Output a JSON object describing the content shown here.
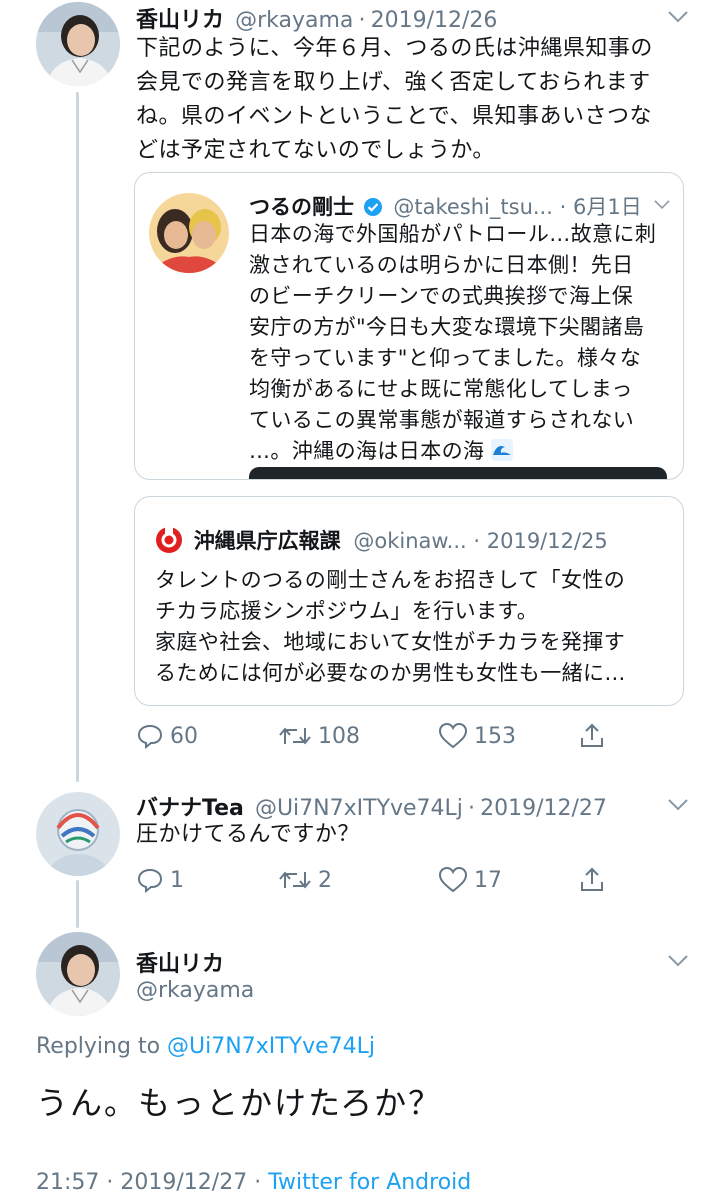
{
  "tweet1": {
    "name": "香山リカ",
    "handle": "@rkayama",
    "sep": "·",
    "date": "2019/12/26",
    "lines": [
      "下記のように、今年６月、つるの氏は沖縄県知事の",
      "会見での発言を取り上げ、強く否定しておられます",
      "ね。県のイベントということで、県知事あいさつな",
      "どは予定されてないのでしょうか。"
    ],
    "quote_outer": {
      "name": "つるの剛士",
      "handle": "@takeshi_tsu...",
      "sep": "·",
      "date": "6月1日",
      "lines": [
        "日本の海で外国船がパトロール…故意に刺",
        "激されているのは明らかに日本側！先日",
        "のビーチクリーンでの式典挨拶で海上保",
        "安庁の方が\"今日も大変な環境下尖閣諸島",
        "を守っています\"と仰ってました。様々な",
        "均衡があるにせよ既に常態化してしまっ",
        "ているこの異常事態が報道すらされない",
        "…。沖縄の海は日本の海"
      ]
    },
    "quote_inner": {
      "name": "沖縄県庁広報課",
      "handle": "@okinaw...",
      "sep": "·",
      "date": "2019/12/25",
      "lines": [
        "タレントのつるの剛士さんをお招きして「女性の",
        "チカラ応援シンポジウム」を行います。",
        "家庭や社会、地域において女性がチカラを発揮す",
        "るためには何が必要なのか男性も女性も一緒に…"
      ]
    },
    "replies": "60",
    "retweets": "108",
    "likes": "153"
  },
  "tweet2": {
    "name": "バナナTea",
    "handle": "@Ui7N7xITYve74Lj",
    "sep": "·",
    "date": "2019/12/27",
    "text": "圧かけてるんですか？",
    "replies": "1",
    "retweets": "2",
    "likes": "17"
  },
  "tweet3": {
    "name": "香山リカ",
    "handle": "@rkayama",
    "replying_prefix": "Replying to",
    "replying_to": "@Ui7N7xITYve74Lj",
    "text": "うん。もっとかけたろか？",
    "time": "21:57",
    "sep": "·",
    "date": "2019/12/27",
    "sep2": "·",
    "source": "Twitter for Android"
  },
  "colors": {
    "accent": "#1da1f2",
    "muted": "#657786",
    "border": "#ccd6dd",
    "text": "#14171a"
  }
}
